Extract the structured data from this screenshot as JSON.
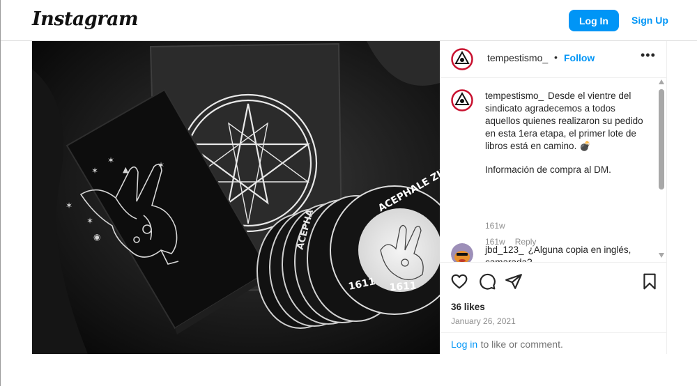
{
  "topbar": {
    "logo": "Instagram",
    "login_label": "Log In",
    "signup_label": "Sign Up"
  },
  "post": {
    "author": "tempestismo_",
    "separator": "•",
    "follow_label": "Follow",
    "more_icon": "more-options-icon",
    "caption": {
      "username": "tempestismo_",
      "text": "Desde el vientre del sindicato agradecemos a todos aquellos quienes realizaron su pedido en esta 1era etapa, el primer lote de libros está en camino. 💣",
      "text2": "Información de compra al DM.",
      "time": "161w"
    },
    "comments": [
      {
        "username": "jbd_123_",
        "text": "¿Alguna copia en inglés, camarada?",
        "time": "161w",
        "reply_label": "Reply"
      }
    ],
    "likes": "36 likes",
    "date": "January 26, 2021",
    "login_prompt": {
      "link": "Log in",
      "text": "to like or comment."
    },
    "photo_text": {
      "sticker_text": "ACEPHALE ZINE",
      "sticker_side": "ACEPHA",
      "year": "1611"
    }
  }
}
